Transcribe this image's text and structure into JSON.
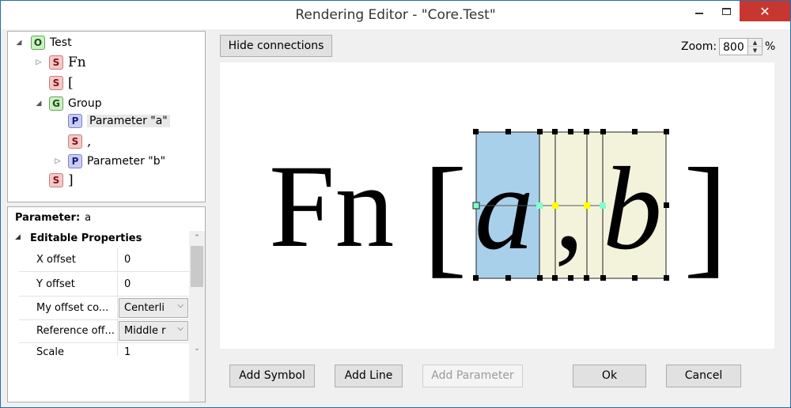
{
  "window": {
    "title": "Rendering Editor - \"Core.Test\""
  },
  "tree": {
    "root": {
      "badge": "O",
      "label": "Test"
    },
    "items": [
      {
        "badge": "S",
        "label": "Fn"
      },
      {
        "badge": "S",
        "label": "["
      },
      {
        "badge": "G",
        "label": "Group"
      },
      {
        "badge": "P",
        "label": "Parameter \"a\""
      },
      {
        "badge": "S",
        "label": ","
      },
      {
        "badge": "P",
        "label": "Parameter \"b\""
      },
      {
        "badge": "S",
        "label": "]"
      }
    ]
  },
  "properties": {
    "title_label": "Parameter:",
    "title_value": "a",
    "section": "Editable Properties",
    "rows": [
      {
        "name": "X offset",
        "value": "0"
      },
      {
        "name": "Y offset",
        "value": "0"
      },
      {
        "name": "My offset co...",
        "value": "Centerli"
      },
      {
        "name": "Reference off...",
        "value": "Middle r"
      },
      {
        "name": "Scale",
        "value": "1"
      }
    ]
  },
  "toolbar": {
    "hide_connections": "Hide connections"
  },
  "zoom": {
    "label": "Zoom:",
    "value": "800",
    "unit": "%"
  },
  "canvas": {
    "glyphs": {
      "fn": "Fn",
      "open_bracket": "[",
      "param_a": "a",
      "comma": ",",
      "param_b": "b",
      "close_bracket": "]"
    },
    "colors": {
      "selected_fill": "#a9d0ea",
      "group_fill": "#f3f3dc",
      "connector_left": "#80ffd0",
      "connector_mid": "#ffff00"
    }
  },
  "buttons": {
    "add_symbol": "Add Symbol",
    "add_line": "Add Line",
    "add_parameter": "Add Parameter",
    "ok": "Ok",
    "cancel": "Cancel"
  }
}
